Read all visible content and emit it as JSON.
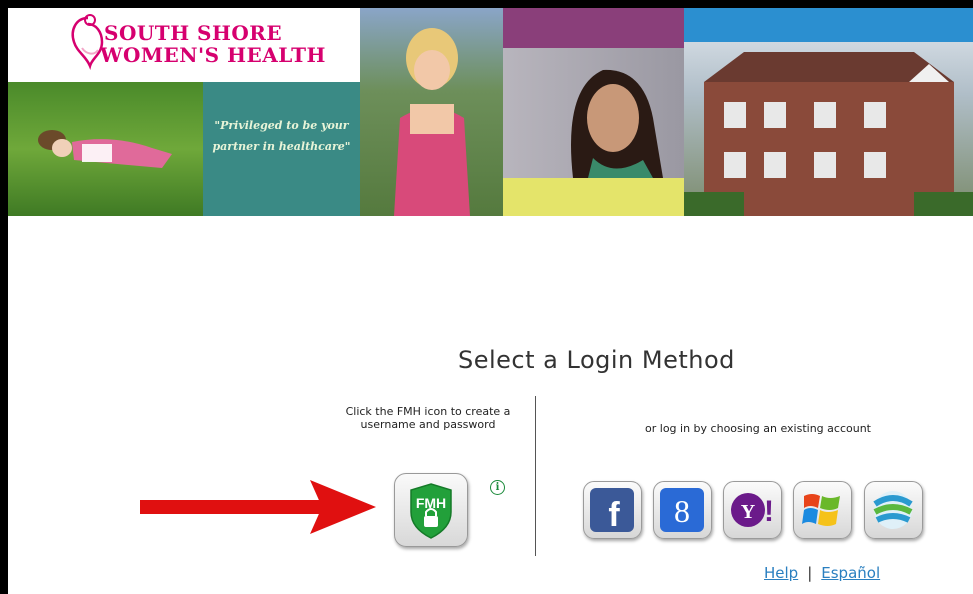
{
  "header": {
    "logo_line1": "SOUTH SHORE",
    "logo_line2": "WOMEN'S HEALTH",
    "tagline": "\"Privileged to be your partner in healthcare\""
  },
  "main": {
    "title": "Select a Login Method",
    "fmh_instructions": "Click the FMH icon to create a username and password",
    "fmh_label": "FMH",
    "info_symbol": "i",
    "existing_account_text": "or log in by choosing an existing account",
    "providers": [
      {
        "name": "facebook",
        "label": "f",
        "color": "#3b5998"
      },
      {
        "name": "google",
        "label": "8",
        "color": "#2a6ad6"
      },
      {
        "name": "yahoo",
        "label": "Y!",
        "color": "#6b1a8a"
      },
      {
        "name": "windows-live",
        "label": "",
        "color": "#f0a020"
      },
      {
        "name": "openid",
        "label": "",
        "color": "#2a9ad0"
      }
    ]
  },
  "footer": {
    "help": "Help",
    "separator": "|",
    "language": "Español"
  },
  "colors": {
    "brand_pink": "#d6006f",
    "teal": "#3a8a85",
    "link": "#2a7fc0",
    "arrow": "#e01010"
  }
}
